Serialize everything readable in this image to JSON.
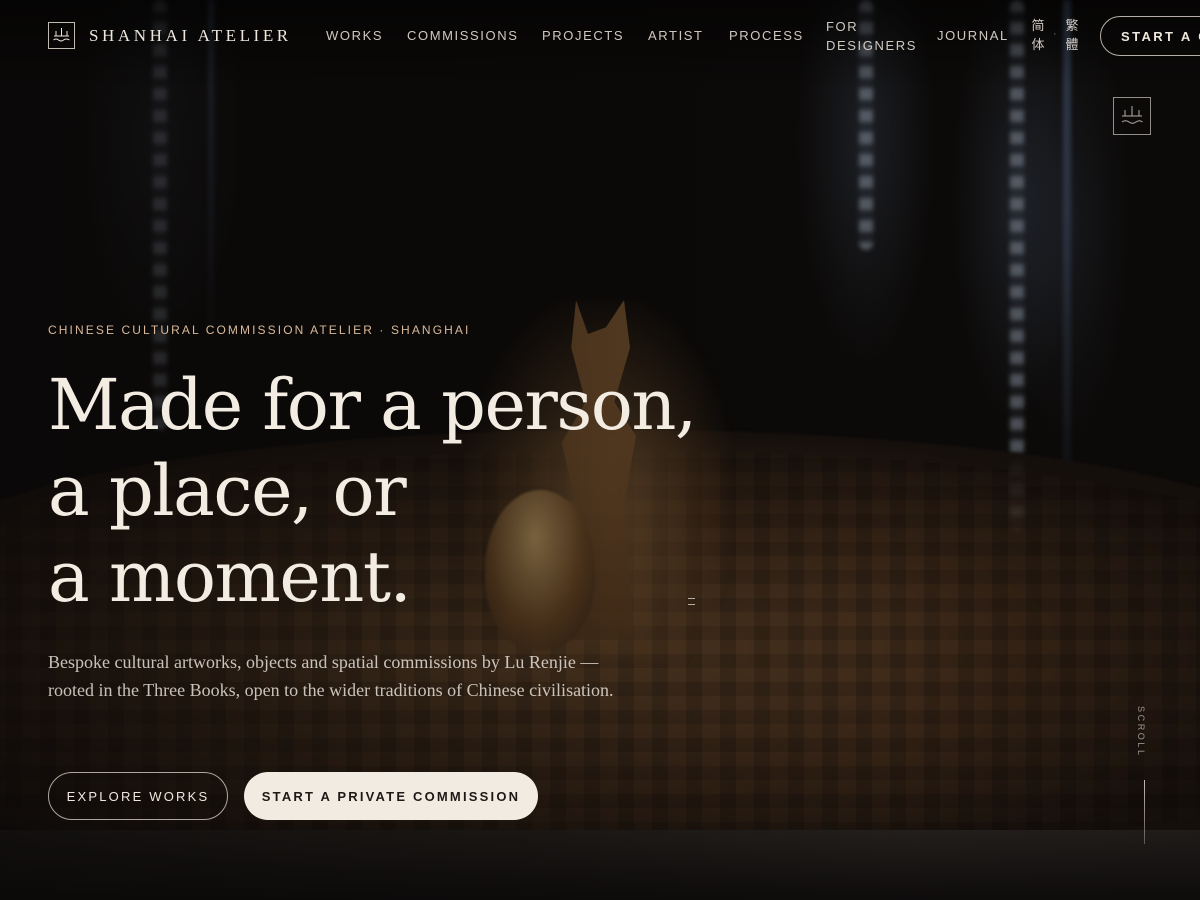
{
  "brand": {
    "name": "SHANHAI ATELIER",
    "logo_icon": "mountain-wave-seal-icon"
  },
  "nav": {
    "items": [
      {
        "label": "WORKS"
      },
      {
        "label": "COMMISSIONS"
      },
      {
        "label": "PROJECTS"
      },
      {
        "label": "ARTIST"
      },
      {
        "label": "PROCESS"
      },
      {
        "label": "FOR DESIGNERS"
      },
      {
        "label": "JOURNAL"
      }
    ],
    "languages": {
      "simplified": "简体",
      "traditional": "繁體",
      "separator": "·"
    },
    "cta_label": "START A C"
  },
  "hero": {
    "eyebrow": "CHINESE CULTURAL COMMISSION ATELIER · SHANGHAI",
    "headline": [
      "Made for a person,",
      "a place, or",
      "a moment."
    ],
    "lede": "Bespoke cultural artworks, objects and spatial commissions by Lu Renjie — rooted in the Three Books, open to the wider traditions of Chinese civilisation.",
    "primary_button": "EXPLORE WORKS",
    "secondary_button": "START A PRIVATE COMMISSION",
    "scroll_label": "SCROLL"
  },
  "colors": {
    "background": "#0c0a09",
    "text": "#efe7dd",
    "eyebrow": "#d9b99a",
    "button_solid": "#f2ebe2"
  }
}
